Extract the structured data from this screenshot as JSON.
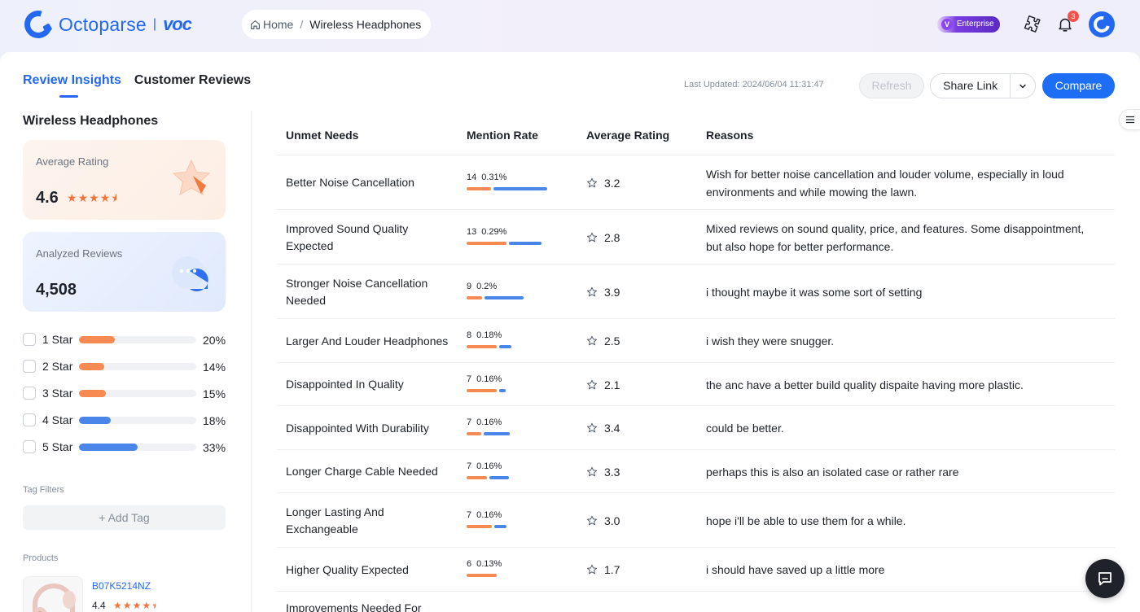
{
  "app": {
    "brand": "Octoparse",
    "product": "VOC"
  },
  "breadcrumb": {
    "home": "Home",
    "separator": "/",
    "current": "Wireless Headphones"
  },
  "header": {
    "enterprise_badge": "Enterprise",
    "notification_count": "3"
  },
  "tabs": [
    {
      "label": "Review Insights",
      "active": true
    },
    {
      "label": "Customer Reviews",
      "active": false
    }
  ],
  "toolbar": {
    "last_updated_label": "Last Updated:",
    "last_updated_value": "2024/06/04 11:31:47",
    "refresh_label": "Refresh",
    "share_label": "Share Link",
    "compare_label": "Compare"
  },
  "sidebar": {
    "product_title": "Wireless Headphones",
    "average_rating": {
      "label": "Average Rating",
      "value": "4.6",
      "stars": 4.6
    },
    "analyzed_reviews": {
      "label": "Analyzed Reviews",
      "value": "4,508"
    },
    "distribution": [
      {
        "label": "1 Star",
        "percent": "20%",
        "fraction": 0.2,
        "color": "#f58a52"
      },
      {
        "label": "2 Star",
        "percent": "14%",
        "fraction": 0.14,
        "color": "#f58a52"
      },
      {
        "label": "3 Star",
        "percent": "15%",
        "fraction": 0.15,
        "color": "#f58a52"
      },
      {
        "label": "4 Star",
        "percent": "18%",
        "fraction": 0.18,
        "color": "#4a86ea"
      },
      {
        "label": "5 Star",
        "percent": "33%",
        "fraction": 0.33,
        "color": "#4a86ea"
      }
    ],
    "tag_filters_label": "Tag Filters",
    "add_tag_label": "+ Add Tag",
    "products_label": "Products",
    "products": [
      {
        "asin": "B07K5214NZ",
        "rating": "4.4"
      }
    ]
  },
  "table": {
    "columns": [
      "Unmet Needs",
      "Mention Rate",
      "Average Rating",
      "Reasons"
    ],
    "rows": [
      {
        "need": "Better Noise Cancellation",
        "count": "14",
        "rate": "0.31%",
        "bar_orange": 0.31,
        "bar_blue": 0.52,
        "rating": "3.2",
        "reason": "Wish for better noise cancellation and louder volume, especially in loud environments and while mowing the lawn."
      },
      {
        "need": "Improved Sound Quality Expected",
        "count": "13",
        "rate": "0.29%",
        "bar_orange": 0.51,
        "bar_blue": 0.32,
        "rating": "2.8",
        "reason": "Mixed reviews on sound quality, price, and features. Some disappointment, but also hope for better performance."
      },
      {
        "need": "Stronger Noise Cancellation Needed",
        "count": "9",
        "rate": "0.2%",
        "bar_orange": 0.2,
        "bar_blue": 0.38,
        "rating": "3.9",
        "reason": "i thought maybe it was some sort of setting"
      },
      {
        "need": "Larger And Louder Headphones",
        "count": "8",
        "rate": "0.18%",
        "bar_orange": 0.38,
        "bar_blue": 0.12,
        "rating": "2.5",
        "reason": "i wish they were snugger."
      },
      {
        "need": "Disappointed In Quality",
        "count": "7",
        "rate": "0.16%",
        "bar_orange": 0.38,
        "bar_blue": 0.06,
        "rating": "2.1",
        "reason": "the anc have a better build quality dispaite having more plastic."
      },
      {
        "need": "Disappointed With Durability",
        "count": "7",
        "rate": "0.16%",
        "bar_orange": 0.19,
        "bar_blue": 0.25,
        "rating": "3.4",
        "reason": "could be better."
      },
      {
        "need": "Longer Charge Cable Needed",
        "count": "7",
        "rate": "0.16%",
        "bar_orange": 0.26,
        "bar_blue": 0.19,
        "rating": "3.3",
        "reason": "perhaps this is also an isolated case or rather rare"
      },
      {
        "need": "Longer Lasting And Exchangeable",
        "count": "7",
        "rate": "0.16%",
        "bar_orange": 0.32,
        "bar_blue": 0.12,
        "rating": "3.0",
        "reason": "hope i'll be able to use them for a while."
      },
      {
        "need": "Higher Quality Expected",
        "count": "6",
        "rate": "0.13%",
        "bar_orange": 0.38,
        "bar_blue": 0.0,
        "rating": "1.7",
        "reason": "i should have saved up a little more"
      },
      {
        "need": "Improvements Needed For",
        "count": "",
        "rate": "",
        "bar_orange": 0,
        "bar_blue": 0,
        "rating": "",
        "reason": ""
      }
    ]
  },
  "colors": {
    "accent": "#1d6ef5",
    "orange": "#f58a52",
    "blue": "#4a86ea"
  }
}
